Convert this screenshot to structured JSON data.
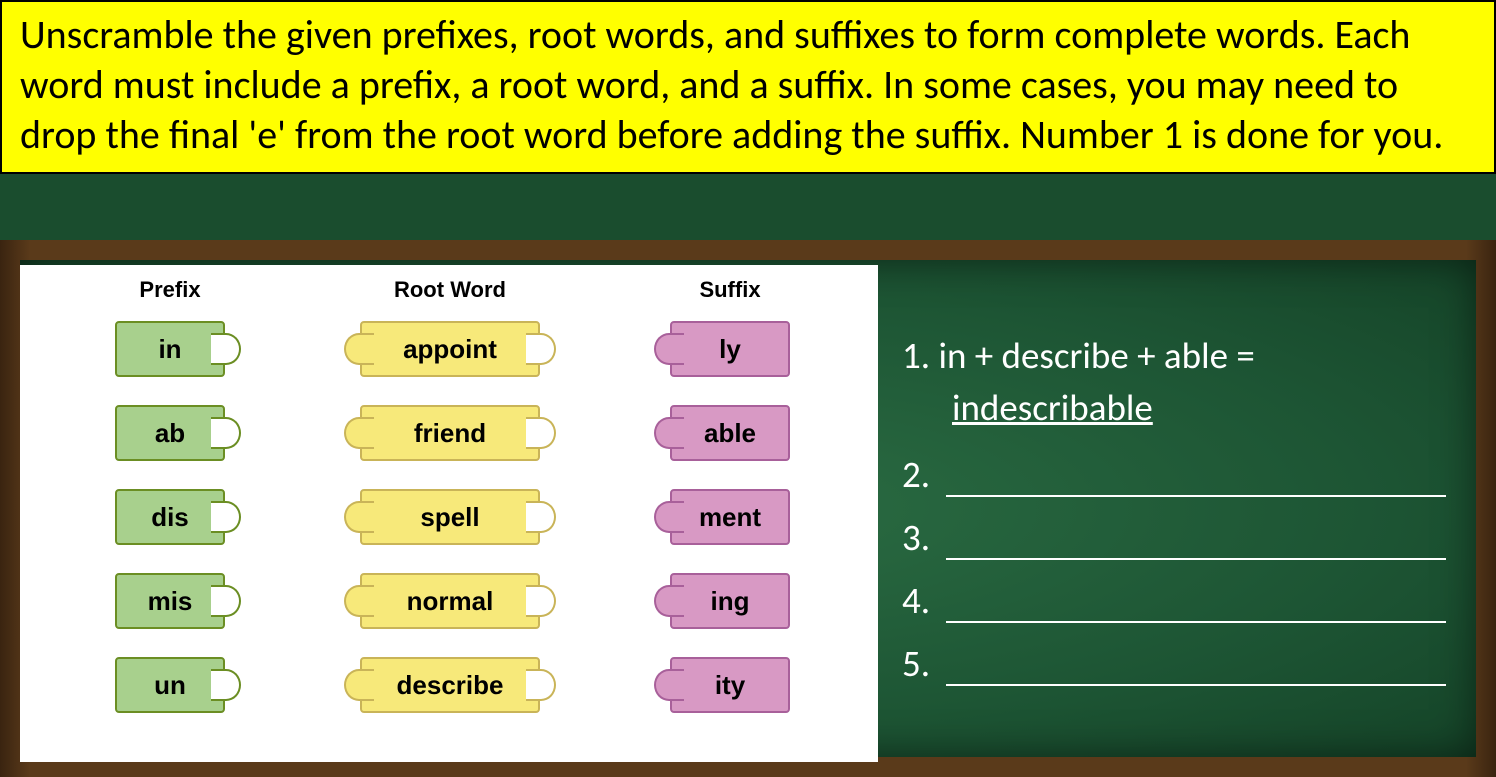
{
  "instructions": "Unscramble the given prefixes, root words, and suffixes to form complete words. Each word must include a prefix, a root word, and a suffix. In some cases, you may need to drop the final 'e' from the root word before adding the suffix. Number 1 is done for you.",
  "columns": {
    "prefix_label": "Prefix",
    "root_label": "Root Word",
    "suffix_label": "Suffix"
  },
  "prefixes": [
    "in",
    "ab",
    "dis",
    "mis",
    "un"
  ],
  "rootwords": [
    "appoint",
    "friend",
    "spell",
    "normal",
    "describe"
  ],
  "suffixes": [
    "ly",
    "able",
    "ment",
    "ing",
    "ity"
  ],
  "answers": {
    "example_num": "1.",
    "example_equation": "in + describe + able =",
    "example_result": "indescribable",
    "blank_nums": [
      "2.",
      "3.",
      "4.",
      "5."
    ]
  }
}
